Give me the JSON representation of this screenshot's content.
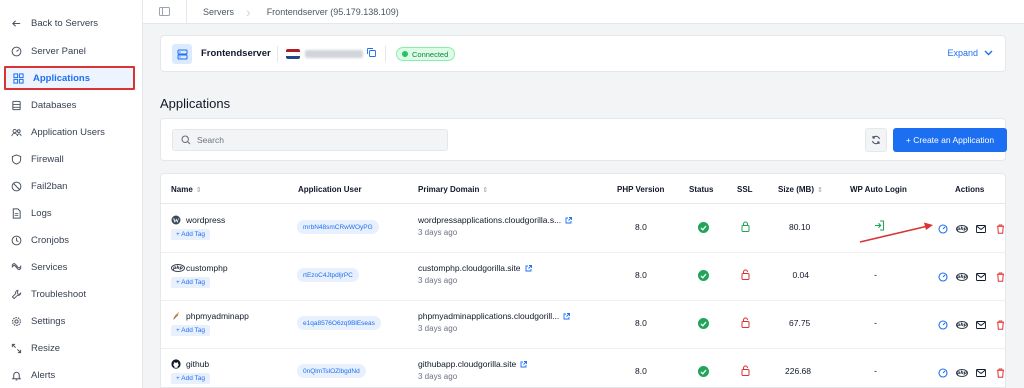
{
  "sidebar": {
    "items": [
      {
        "label": "Back to Servers",
        "icon": "arrow-left-icon"
      },
      {
        "label": "Server Panel",
        "icon": "gauge-icon"
      },
      {
        "label": "Applications",
        "icon": "applications-icon",
        "active": true
      },
      {
        "label": "Databases",
        "icon": "database-icon"
      },
      {
        "label": "Application Users",
        "icon": "users-icon"
      },
      {
        "label": "Firewall",
        "icon": "shield-icon"
      },
      {
        "label": "Fail2ban",
        "icon": "ban-icon"
      },
      {
        "label": "Logs",
        "icon": "file-icon"
      },
      {
        "label": "Cronjobs",
        "icon": "clock-icon"
      },
      {
        "label": "Services",
        "icon": "services-icon"
      },
      {
        "label": "Troubleshoot",
        "icon": "wrench-icon"
      },
      {
        "label": "Settings",
        "icon": "gear-icon"
      },
      {
        "label": "Resize",
        "icon": "resize-icon"
      },
      {
        "label": "Alerts",
        "icon": "bell-icon"
      }
    ]
  },
  "breadcrumb": {
    "items": [
      "Servers",
      "Frontendserver (95.179.138.109)"
    ]
  },
  "server": {
    "name": "Frontendserver",
    "status": "Connected",
    "expand_label": "Expand"
  },
  "page": {
    "title": "Applications"
  },
  "toolbar": {
    "search_placeholder": "Search",
    "create_label": "+ Create an Application"
  },
  "table": {
    "headers": {
      "name": "Name",
      "user": "Application User",
      "domain": "Primary Domain",
      "php": "PHP Version",
      "status": "Status",
      "ssl": "SSL",
      "size": "Size (MB)",
      "auto_login": "WP Auto Login",
      "actions": "Actions"
    },
    "add_tag_label": "+ Add Tag",
    "rows": [
      {
        "name": "wordpress",
        "icon": "wordpress-icon",
        "user": "mrbN48smCRwWOyPG",
        "domain": "wordpressapplications.cloudgorilla.s...",
        "ago": "3 days ago",
        "php": "8.0",
        "ssl": "on",
        "size": "80.10",
        "auto_login": "login-icon"
      },
      {
        "name": "customphp",
        "icon": "php-icon",
        "user": "rtEzoC4JtpdljrPC",
        "domain": "customphp.cloudgorilla.site",
        "ago": "3 days ago",
        "php": "8.0",
        "ssl": "off",
        "size": "0.04",
        "auto_login": "-"
      },
      {
        "name": "phpmyadminapp",
        "icon": "phpmyadmin-icon",
        "user": "e1qa8576O6zq9BlEseas",
        "domain": "phpmyadminapplications.cloudgorill...",
        "ago": "3 days ago",
        "php": "8.0",
        "ssl": "off",
        "size": "67.75",
        "auto_login": "-"
      },
      {
        "name": "github",
        "icon": "github-icon",
        "user": "0nQlmTslOZlbgdNd",
        "domain": "githubapp.cloudgorilla.site",
        "ago": "3 days ago",
        "php": "8.0",
        "ssl": "off",
        "size": "226.68",
        "auto_login": "-"
      }
    ]
  },
  "colors": {
    "accent": "#1d6ff2",
    "success": "#22a55a",
    "danger": "#e03131",
    "highlight": "#d93434"
  }
}
